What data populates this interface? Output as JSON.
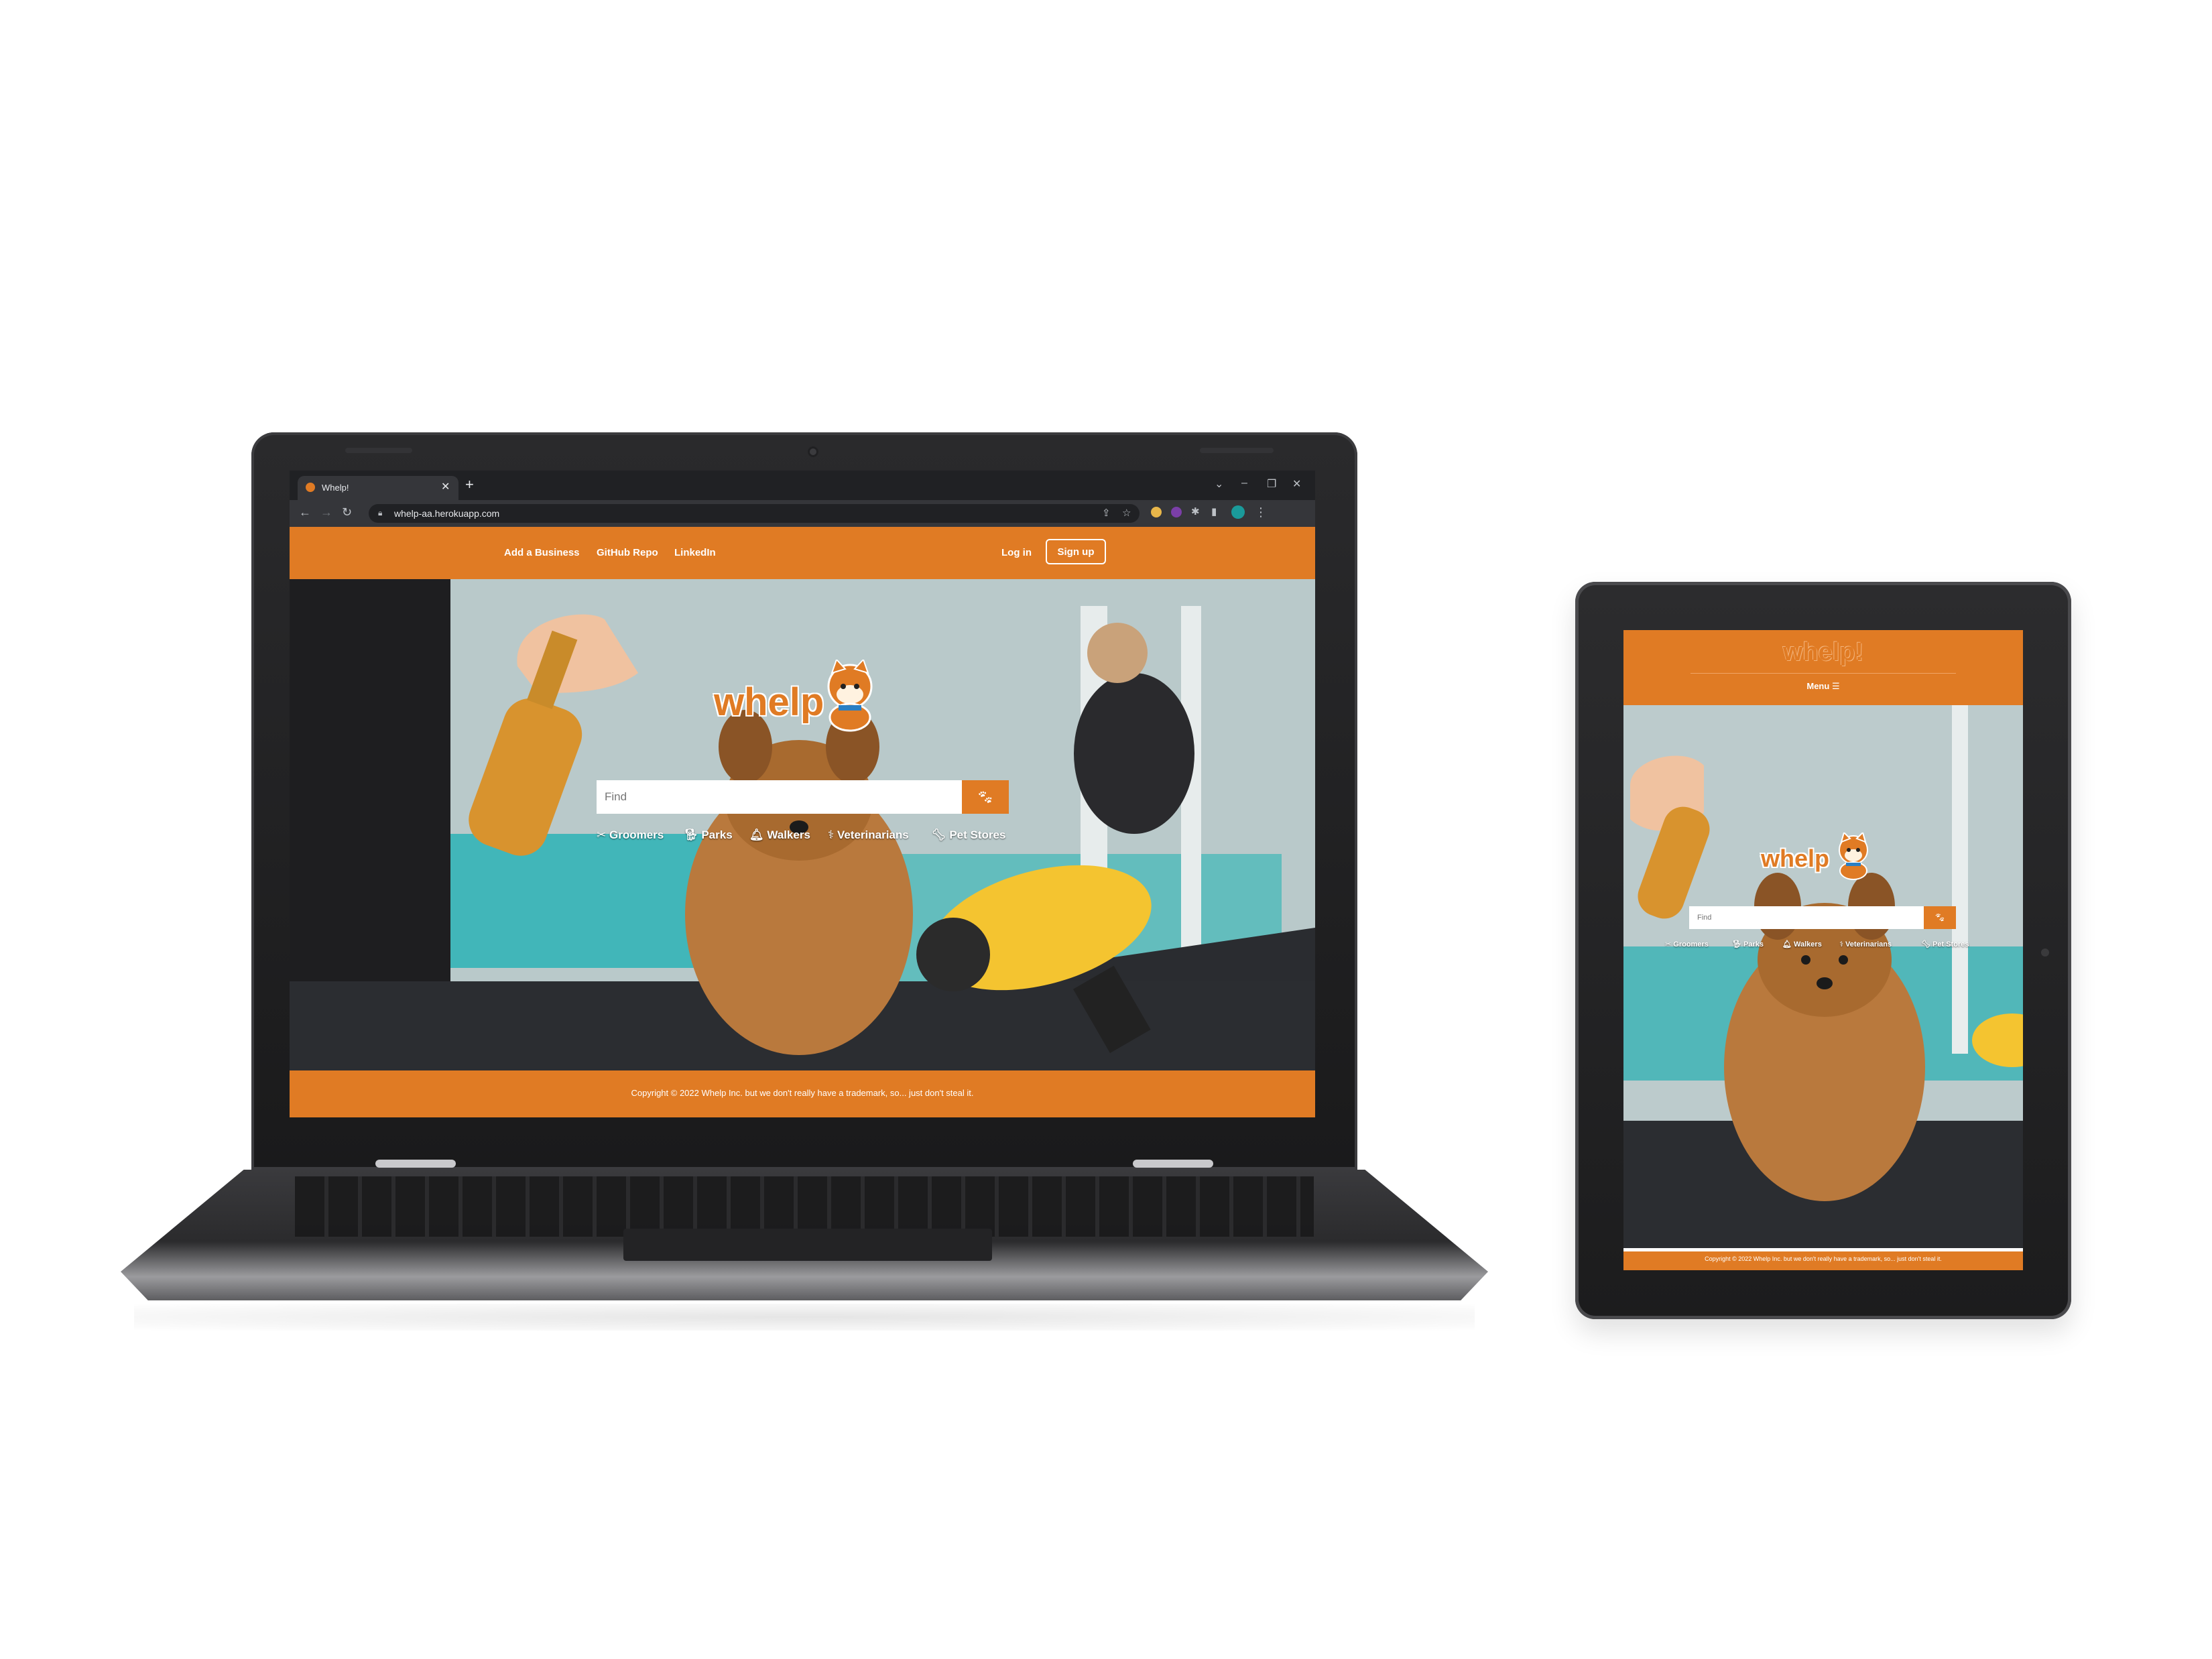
{
  "colors": {
    "brand_orange": "#e07b24",
    "chrome_dark": "#202124",
    "chrome_toolbar": "#35363a"
  },
  "browser": {
    "tab_title": "Whelp!",
    "url": "whelp-aa.herokuapp.com",
    "window_controls": {
      "minimize": "–",
      "restore": "❐",
      "close": "✕"
    }
  },
  "laptop_page": {
    "nav": {
      "add_business": "Add a Business",
      "github": "GitHub Repo",
      "linkedin": "LinkedIn",
      "login": "Log in",
      "signup": "Sign up"
    },
    "logo": "whelp",
    "search_placeholder": "Find",
    "categories": [
      "Groomers",
      "Parks",
      "Walkers",
      "Veterinarians",
      "Pet Stores"
    ],
    "footer": "Copyright © 2022 Whelp Inc. but we don't really have a trademark, so... just don't steal it."
  },
  "tablet_page": {
    "brand": "whelp!",
    "menu": "Menu",
    "logo": "whelp",
    "search_placeholder": "Find",
    "categories": [
      "Groomers",
      "Parks",
      "Walkers",
      "Veterinarians",
      "Pet Stores"
    ],
    "footer": "Copyright © 2022 Whelp Inc. but we don't really have a trademark, so... just don't steal it."
  }
}
